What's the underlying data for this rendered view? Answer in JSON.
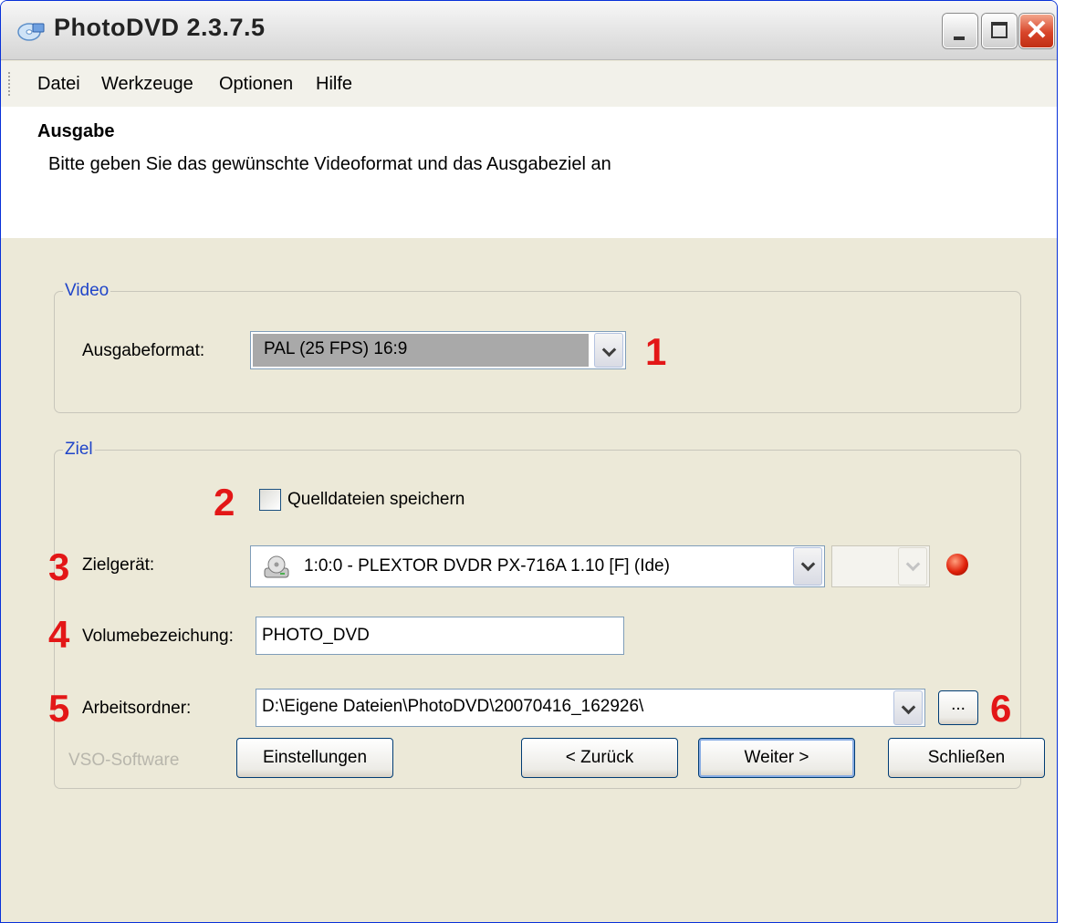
{
  "window": {
    "title": "PhotoDVD 2.3.7.5"
  },
  "menu": [
    "Datei",
    "Werkzeuge",
    "Optionen",
    "Hilfe"
  ],
  "header": {
    "title": "Ausgabe",
    "subtitle": "Bitte geben Sie das gewünschte Videoformat und das Ausgabeziel an"
  },
  "video_group": {
    "legend": "Video",
    "format_label": "Ausgabeformat:",
    "format_value": "PAL (25 FPS) 16:9"
  },
  "target_group": {
    "legend": "Ziel",
    "save_sources_label": "Quelldateien speichern",
    "save_sources_checked": false,
    "device_label": "Zielgerät:",
    "device_value": "1:0:0 - PLEXTOR DVDR   PX-716A 1.10 [F] (Ide)",
    "volume_label": "Volumebezeichung:",
    "volume_value": "PHOTO_DVD",
    "workdir_label": "Arbeitsordner:",
    "workdir_value": "D:\\Eigene Dateien\\PhotoDVD\\20070416_162926\\",
    "browse_label": "..."
  },
  "annotations": [
    "1",
    "2",
    "3",
    "4",
    "5",
    "6"
  ],
  "footer": {
    "brand": "VSO-Software",
    "settings_label": "Einstellungen",
    "back_label": "< Zurück",
    "next_label": "Weiter >",
    "close_label": "Schließen"
  },
  "colors": {
    "annotation": "#e31717",
    "legend": "#2045c9",
    "dialog_bg": "#ece9d8",
    "led": "#e0210a"
  },
  "icons": [
    "photodvd-app-icon",
    "minimize-icon",
    "maximize-icon",
    "close-icon",
    "dvd-drive-icon",
    "chevron-down-icon",
    "status-led-icon"
  ]
}
